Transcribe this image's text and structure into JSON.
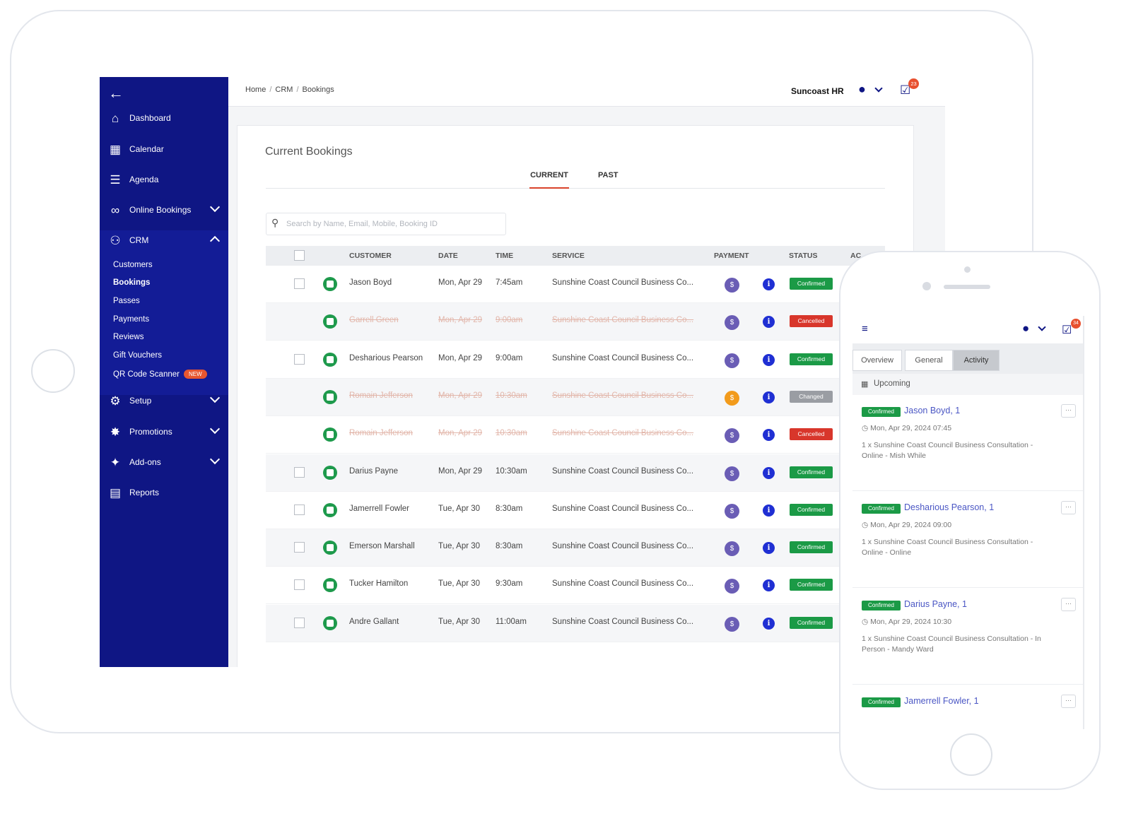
{
  "sidebar": {
    "back_icon": "arrow-left-icon",
    "items": [
      {
        "label": "Dashboard",
        "icon": "home-icon"
      },
      {
        "label": "Calendar",
        "icon": "calendar-icon"
      },
      {
        "label": "Agenda",
        "icon": "list-icon"
      },
      {
        "label": "Online Bookings",
        "icon": "link-icon"
      },
      {
        "label": "CRM",
        "icon": "users-icon"
      },
      {
        "label": "Setup",
        "icon": "gears-icon"
      },
      {
        "label": "Promotions",
        "icon": "badge-icon"
      },
      {
        "label": "Add-ons",
        "icon": "puzzle-icon"
      },
      {
        "label": "Reports",
        "icon": "document-icon"
      }
    ],
    "crm_sub": [
      "Customers",
      "Bookings",
      "Passes",
      "Payments",
      "Reviews",
      "Gift Vouchers",
      "QR Code Scanner"
    ],
    "new_badge": "NEW"
  },
  "topbar": {
    "breadcrumb": [
      "Home",
      "CRM",
      "Bookings"
    ],
    "org": "Suncoast HR",
    "notifications": "23"
  },
  "main": {
    "title": "Current Bookings",
    "tabs": [
      "CURRENT",
      "PAST"
    ],
    "search_placeholder": "Search by Name, Email, Mobile, Booking ID",
    "columns": [
      "CUSTOMER",
      "DATE",
      "TIME",
      "SERVICE",
      "PAYMENT",
      "STATUS",
      "AC"
    ],
    "rows": [
      {
        "customer": "Jason Boyd",
        "date": "Mon, Apr 29",
        "time": "7:45am",
        "service": "Sunshine Coast Council Business Co...",
        "payment": "$",
        "status": "Confirmed",
        "struck": false,
        "checkbox": true
      },
      {
        "customer": "Garrell Green",
        "date": "Mon, Apr 29",
        "time": "9:00am",
        "service": "Sunshine Coast Council Business Co...",
        "payment": "$",
        "status": "Cancelled",
        "struck": true,
        "checkbox": false
      },
      {
        "customer": "Desharious Pearson",
        "date": "Mon, Apr 29",
        "time": "9:00am",
        "service": "Sunshine Coast Council Business Co...",
        "payment": "$",
        "status": "Confirmed",
        "struck": false,
        "checkbox": true
      },
      {
        "customer": "Romain Jefferson",
        "date": "Mon, Apr 29",
        "time": "10:30am",
        "service": "Sunshine Coast Council Business Co...",
        "payment": "$",
        "status": "Changed",
        "struck": true,
        "checkbox": false,
        "payment_color": "orange"
      },
      {
        "customer": "Romain Jefferson",
        "date": "Mon, Apr 29",
        "time": "10:30am",
        "service": "Sunshine Coast Council Business Co...",
        "payment": "$",
        "status": "Cancelled",
        "struck": true,
        "checkbox": false
      },
      {
        "customer": "Darius Payne",
        "date": "Mon, Apr 29",
        "time": "10:30am",
        "service": "Sunshine Coast Council Business Co...",
        "payment": "$",
        "status": "Confirmed",
        "struck": false,
        "checkbox": true
      },
      {
        "customer": "Jamerrell Fowler",
        "date": "Tue, Apr 30",
        "time": "8:30am",
        "service": "Sunshine Coast Council Business Co...",
        "payment": "$",
        "status": "Confirmed",
        "struck": false,
        "checkbox": true
      },
      {
        "customer": "Emerson Marshall",
        "date": "Tue, Apr 30",
        "time": "8:30am",
        "service": "Sunshine Coast Council Business Co...",
        "payment": "$",
        "status": "Confirmed",
        "struck": false,
        "checkbox": true
      },
      {
        "customer": "Tucker Hamilton",
        "date": "Tue, Apr 30",
        "time": "9:30am",
        "service": "Sunshine Coast Council Business Co...",
        "payment": "$",
        "status": "Confirmed",
        "struck": false,
        "checkbox": true
      },
      {
        "customer": "Andre Gallant",
        "date": "Tue, Apr 30",
        "time": "11:00am",
        "service": "Sunshine Coast Council Business Co...",
        "payment": "$",
        "status": "Confirmed",
        "struck": false,
        "checkbox": true
      }
    ]
  },
  "phone": {
    "notifications": "34",
    "tabs": [
      "Overview",
      "General",
      "Activity"
    ],
    "active_tab": "Activity",
    "section": "Upcoming",
    "more_label": "···",
    "cards": [
      {
        "status": "Confirmed",
        "name": "Jason Boyd, 1",
        "date": "Mon, Apr 29, 2024 07:45",
        "desc": "1 x Sunshine Coast Council Business Consultation - Online - Mish While"
      },
      {
        "status": "Confirmed",
        "name": "Desharious Pearson, 1",
        "date": "Mon, Apr 29, 2024 09:00",
        "desc": "1 x Sunshine Coast Council Business Consultation - Online - Online"
      },
      {
        "status": "Confirmed",
        "name": "Darius Payne, 1",
        "date": "Mon, Apr 29, 2024 10:30",
        "desc": "1 x Sunshine Coast Council Business Consultation - In Person - Mandy Ward"
      },
      {
        "status": "Confirmed",
        "name": "Jamerrell Fowler, 1",
        "date": "",
        "desc": ""
      }
    ]
  }
}
